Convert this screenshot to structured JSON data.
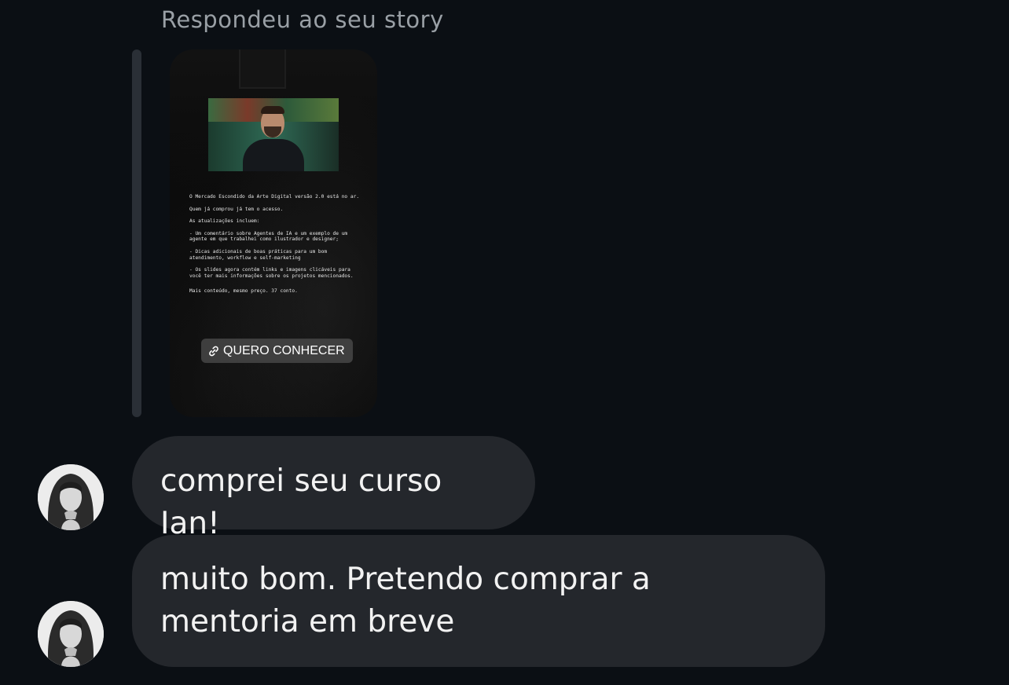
{
  "story_reply": {
    "header": "Respondeu ao seu story",
    "story": {
      "lines": [
        "O Mercado Escondido da Arte Digital versão 2.0 está no ar.",
        "Quem já comprou já tem o acesso.",
        "As atualizações incluem:",
        "- Um comentário sobre Agentes de IA e um exemplo de um agente em que trabalhei como ilustrador e designer;",
        "- Dicas adicionais de boas práticas para um bom atendimento, workflow e self-marketing",
        "- Os slides agora contém links e imagens clicáveis para você ter mais informações sobre os projetos mencionados.",
        "Mais conteúdo, mesmo preço. 37 conto."
      ],
      "link_label": "QUERO CONHECER",
      "link_icon": "link-icon"
    }
  },
  "messages": [
    {
      "text": "comprei seu curso Ian!",
      "avatar": "user-avatar"
    },
    {
      "text": "muito bom. Pretendo comprar a mentoria em breve",
      "avatar": "user-avatar"
    }
  ],
  "colors": {
    "background": "#0b0f14",
    "bubble": "#24272c",
    "header_text": "#9aa0a6",
    "message_text": "#f2f2f2"
  }
}
